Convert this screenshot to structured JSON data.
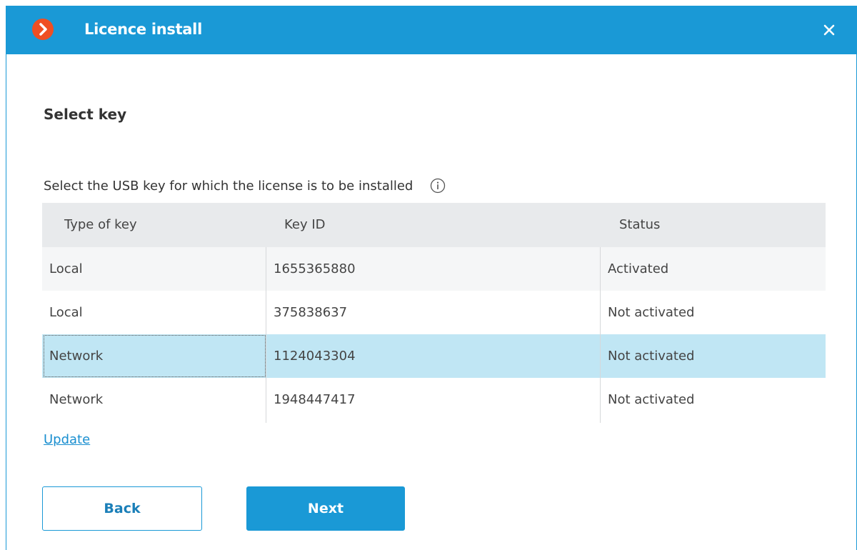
{
  "window": {
    "title": "Licence install",
    "accent_color": "#1a99d6",
    "logo_color": "#ef4f23",
    "logo_icon": "chevron-right-icon",
    "close_icon": "close-icon"
  },
  "step": {
    "title": "Select key",
    "description": "Select the USB key for which the license is to be installed",
    "info_icon": "info-icon"
  },
  "table": {
    "columns": [
      "Type of key",
      "Key ID",
      "Status"
    ],
    "rows": [
      {
        "type": "Local",
        "key_id": "1655365880",
        "status": "Activated"
      },
      {
        "type": "Local",
        "key_id": "375838637",
        "status": "Not activated"
      },
      {
        "type": "Network",
        "key_id": "1124043304",
        "status": "Not activated"
      },
      {
        "type": "Network",
        "key_id": "1948447417",
        "status": "Not activated"
      }
    ],
    "selected_row": 2,
    "selected_color": "#c0e6f4"
  },
  "links": {
    "update": "Update"
  },
  "buttons": {
    "back": "Back",
    "next": "Next"
  }
}
